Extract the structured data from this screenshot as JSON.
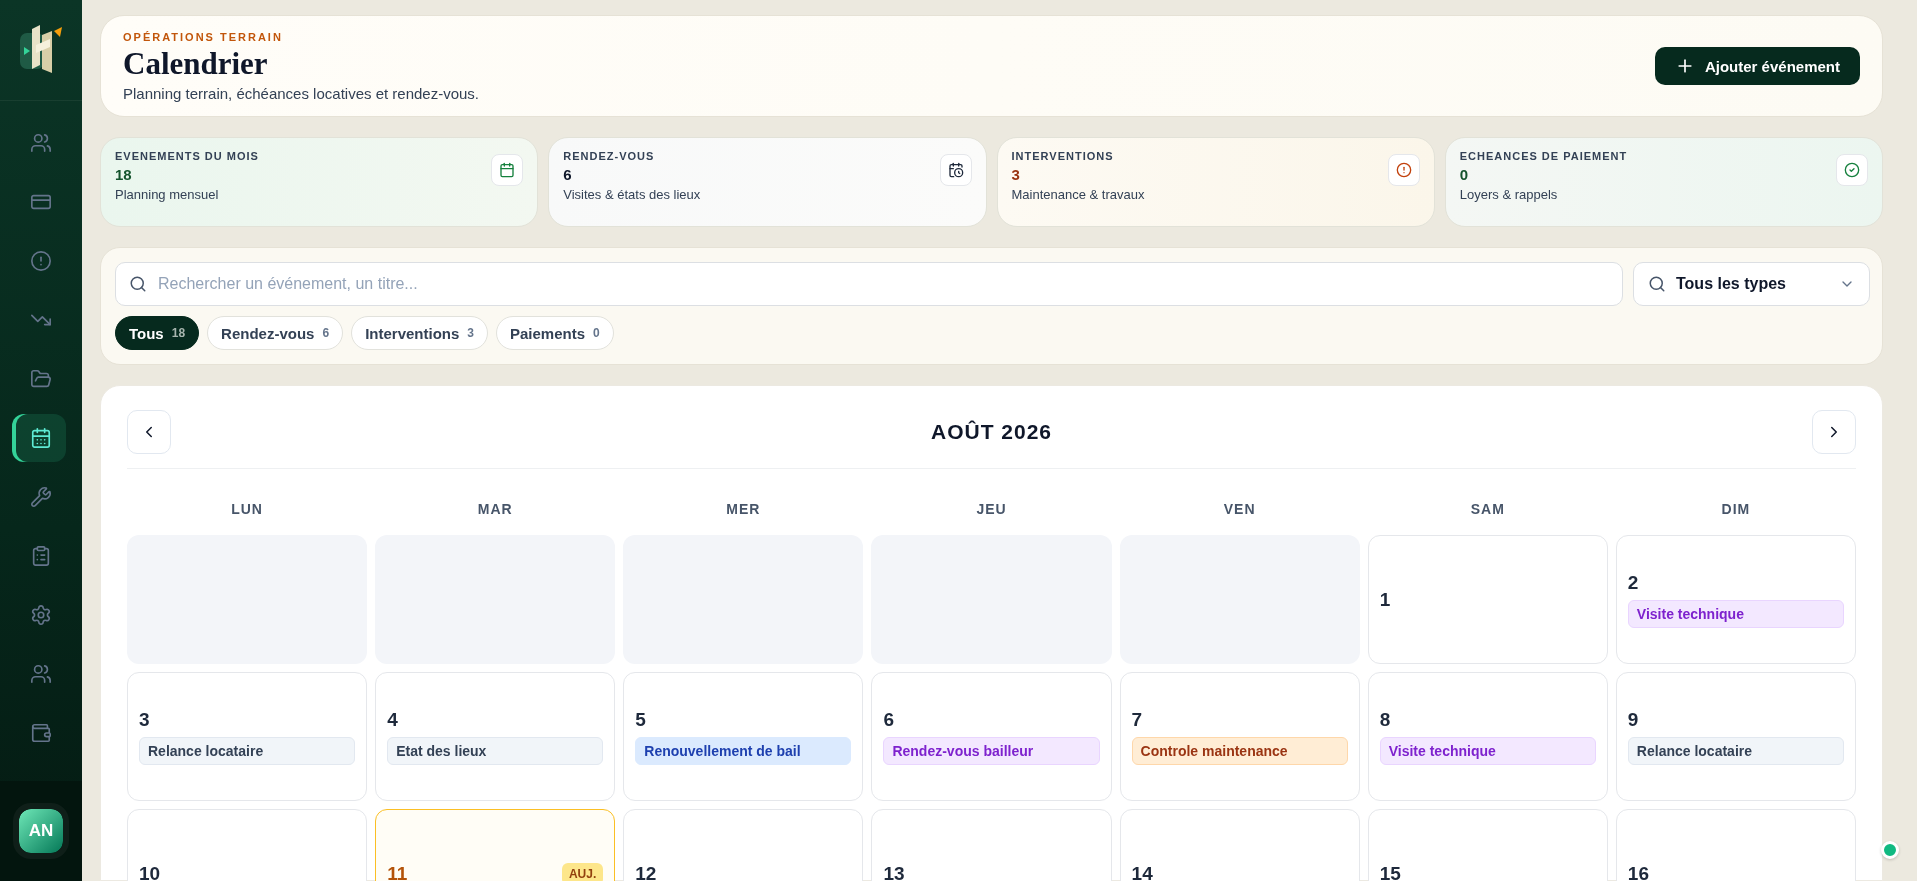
{
  "sidebar": {
    "items": [
      {
        "kind": "people",
        "selected": false
      },
      {
        "kind": "card",
        "selected": false
      },
      {
        "kind": "alert",
        "selected": false
      },
      {
        "kind": "trend",
        "selected": false
      },
      {
        "kind": "folder",
        "selected": false
      },
      {
        "kind": "calendar",
        "selected": true
      },
      {
        "kind": "wrench",
        "selected": false
      },
      {
        "kind": "clipboard",
        "selected": false
      },
      {
        "kind": "settings",
        "selected": false
      },
      {
        "kind": "people",
        "selected": false
      },
      {
        "kind": "wallet",
        "selected": false
      }
    ],
    "avatar": "AN"
  },
  "header": {
    "eyebrow": "OPÉRATIONS TERRAIN",
    "title": "Calendrier",
    "subtitle": "Planning terrain, échéances locatives et rendez-vous.",
    "action": "Ajouter événement"
  },
  "stats": [
    {
      "kind": "month",
      "label": "EVENEMENTS DU MOIS",
      "value": "18",
      "caption": "Planning mensuel"
    },
    {
      "kind": "appointments",
      "label": "RENDEZ-VOUS",
      "value": "6",
      "caption": "Visites & états des lieux"
    },
    {
      "kind": "interventions",
      "label": "INTERVENTIONS",
      "value": "3",
      "caption": "Maintenance & travaux"
    },
    {
      "kind": "payments",
      "label": "ECHEANCES DE PAIEMENT",
      "value": "0",
      "caption": "Loyers & rappels"
    }
  ],
  "search": {
    "placeholder": "Rechercher un événement, un titre..."
  },
  "type_filter": {
    "value": "Tous les types"
  },
  "chips": [
    {
      "label": "Tous",
      "count": "18",
      "selected": true
    },
    {
      "label": "Rendez-vous",
      "count": "6",
      "selected": false
    },
    {
      "label": "Interventions",
      "count": "3",
      "selected": false
    },
    {
      "label": "Paiements",
      "count": "0",
      "selected": false
    }
  ],
  "calendar": {
    "month": "AOÛT 2026",
    "weekdays": [
      "LUN",
      "MAR",
      "MER",
      "JEU",
      "VEN",
      "SAM",
      "DIM"
    ],
    "weeks": [
      [
        {
          "kind": "blank"
        },
        {
          "kind": "blank"
        },
        {
          "kind": "blank"
        },
        {
          "kind": "blank"
        },
        {
          "kind": "blank"
        },
        {
          "kind": "day",
          "day": "1",
          "today": false
        },
        {
          "kind": "day",
          "day": "2",
          "today": false,
          "events": [
            {
              "title": "Visite technique",
              "kind": "visit"
            }
          ]
        }
      ],
      [
        {
          "kind": "day",
          "day": "3",
          "today": false,
          "events": [
            {
              "title": "Relance locataire",
              "kind": "reminder"
            }
          ]
        },
        {
          "kind": "day",
          "day": "4",
          "today": false,
          "events": [
            {
              "title": "Etat des lieux",
              "kind": "reminder"
            }
          ]
        },
        {
          "kind": "day",
          "day": "5",
          "today": false,
          "events": [
            {
              "title": "Renouvellement de bail",
              "kind": "lease"
            }
          ]
        },
        {
          "kind": "day",
          "day": "6",
          "today": false,
          "events": [
            {
              "title": "Rendez-vous bailleur",
              "kind": "visit"
            }
          ]
        },
        {
          "kind": "day",
          "day": "7",
          "today": false,
          "events": [
            {
              "title": "Controle maintenance",
              "kind": "maintenance"
            }
          ]
        },
        {
          "kind": "day",
          "day": "8",
          "today": false,
          "events": [
            {
              "title": "Visite technique",
              "kind": "visit"
            }
          ]
        },
        {
          "kind": "day",
          "day": "9",
          "today": false,
          "events": [
            {
              "title": "Relance locataire",
              "kind": "reminder"
            }
          ]
        }
      ],
      [
        {
          "kind": "day",
          "day": "10",
          "today": false
        },
        {
          "kind": "day",
          "day": "11",
          "today": true,
          "badge": "AUJ."
        },
        {
          "kind": "day",
          "day": "12",
          "today": false
        },
        {
          "kind": "day",
          "day": "13",
          "today": false
        },
        {
          "kind": "day",
          "day": "14",
          "today": false
        },
        {
          "kind": "day",
          "day": "15",
          "today": false
        },
        {
          "kind": "day",
          "day": "16",
          "today": false
        }
      ]
    ]
  }
}
